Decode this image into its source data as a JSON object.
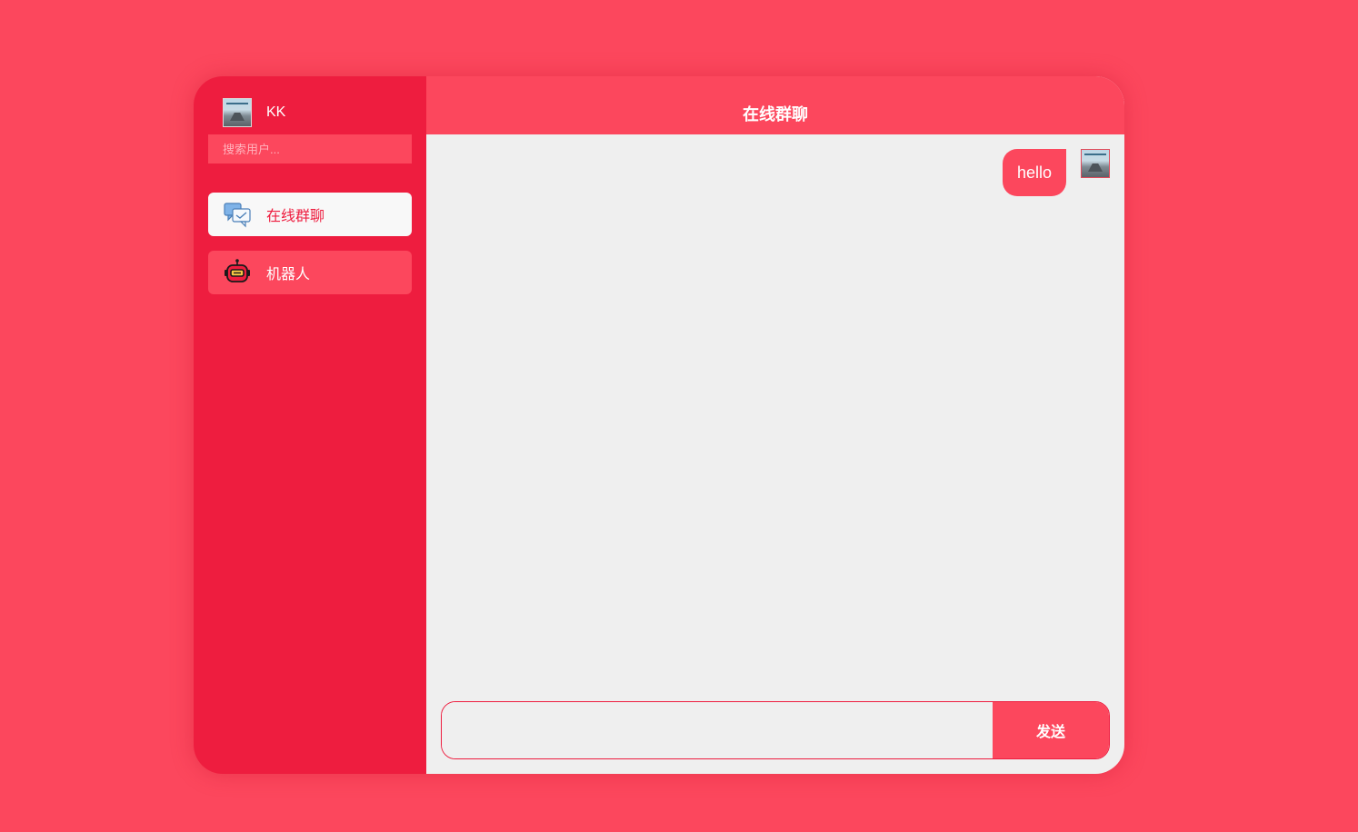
{
  "user": {
    "name": "KK"
  },
  "search": {
    "placeholder": "搜索用户..."
  },
  "nav": {
    "items": [
      {
        "label": "在线群聊",
        "icon": "group-chat-icon",
        "active": true
      },
      {
        "label": "机器人",
        "icon": "robot-icon",
        "active": false
      }
    ]
  },
  "chat": {
    "title": "在线群聊",
    "messages": [
      {
        "text": "hello",
        "self": true
      }
    ],
    "input_value": "",
    "send_label": "发送"
  },
  "colors": {
    "page_background": "#fc475d",
    "sidebar_background": "#ee1d3f",
    "accent": "#fc475d",
    "chat_background": "#efefef",
    "active_item_background": "#f8f8f8"
  }
}
